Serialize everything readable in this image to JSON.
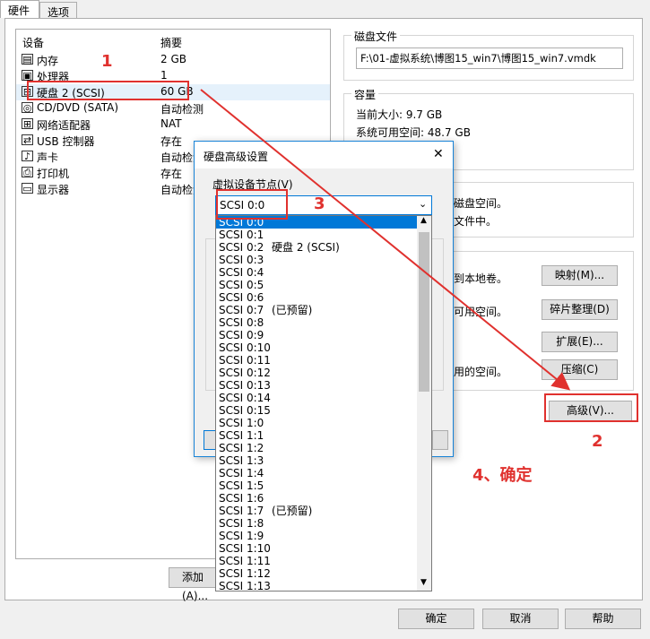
{
  "tabs": [
    "硬件",
    "选项"
  ],
  "device_list": {
    "col_device": "设备",
    "col_summary": "摘要",
    "rows": [
      {
        "icon": "memory-icon",
        "name": "内存",
        "summary": "2 GB"
      },
      {
        "icon": "cpu-icon",
        "name": "处理器",
        "summary": "1"
      },
      {
        "icon": "hard-disk-icon",
        "name": "硬盘 2 (SCSI)",
        "summary": "60 GB"
      },
      {
        "icon": "cd-dvd-icon",
        "name": "CD/DVD (SATA)",
        "summary": "自动检测"
      },
      {
        "icon": "network-adapter-icon",
        "name": "网络适配器",
        "summary": "NAT"
      },
      {
        "icon": "usb-icon",
        "name": "USB 控制器",
        "summary": "存在"
      },
      {
        "icon": "sound-icon",
        "name": "声卡",
        "summary": "自动检测"
      },
      {
        "icon": "printer-icon",
        "name": "打印机",
        "summary": "存在"
      },
      {
        "icon": "display-icon",
        "name": "显示器",
        "summary": "自动检测"
      }
    ]
  },
  "add_button": "添加(A)...",
  "disk_file": {
    "title": "磁盘文件",
    "path": "F:\\01-虚拟系统\\博图15_win7\\博图15_win7.vmdk"
  },
  "capacity": {
    "title": "容量",
    "current_size": "当前大小: 9.7 GB",
    "free_space": "系统可用空间: 48.7 GB"
  },
  "disk_info": {
    "line1": "磁盘空间。",
    "line2": "文件中。"
  },
  "utilities": {
    "map_text": "到本地卷。",
    "map_btn": "映射(M)...",
    "defrag_text": "可用空间。",
    "defrag_btn": "碎片整理(D)",
    "expand_btn": "扩展(E)...",
    "compact_text": "用的空间。",
    "compact_btn": "压缩(C)"
  },
  "advanced_btn": "高级(V)...",
  "bottom": {
    "ok": "确定",
    "cancel": "取消",
    "help": "帮助"
  },
  "dialog": {
    "title": "硬盘高级设置",
    "close": "✕",
    "node_label": "虚拟设备节点(V)",
    "selected": "SCSI 0:0",
    "options": [
      {
        "label": "SCSI 0:0",
        "extra": ""
      },
      {
        "label": "SCSI 0:1",
        "extra": ""
      },
      {
        "label": "SCSI 0:2",
        "extra": "硬盘 2 (SCSI)"
      },
      {
        "label": "SCSI 0:3",
        "extra": ""
      },
      {
        "label": "SCSI 0:4",
        "extra": ""
      },
      {
        "label": "SCSI 0:5",
        "extra": ""
      },
      {
        "label": "SCSI 0:6",
        "extra": ""
      },
      {
        "label": "SCSI 0:7",
        "extra": "(已预留)"
      },
      {
        "label": "SCSI 0:8",
        "extra": ""
      },
      {
        "label": "SCSI 0:9",
        "extra": ""
      },
      {
        "label": "SCSI 0:10",
        "extra": ""
      },
      {
        "label": "SCSI 0:11",
        "extra": ""
      },
      {
        "label": "SCSI 0:12",
        "extra": ""
      },
      {
        "label": "SCSI 0:13",
        "extra": ""
      },
      {
        "label": "SCSI 0:14",
        "extra": ""
      },
      {
        "label": "SCSI 0:15",
        "extra": ""
      },
      {
        "label": "SCSI 1:0",
        "extra": ""
      },
      {
        "label": "SCSI 1:1",
        "extra": ""
      },
      {
        "label": "SCSI 1:2",
        "extra": ""
      },
      {
        "label": "SCSI 1:3",
        "extra": ""
      },
      {
        "label": "SCSI 1:4",
        "extra": ""
      },
      {
        "label": "SCSI 1:5",
        "extra": ""
      },
      {
        "label": "SCSI 1:6",
        "extra": ""
      },
      {
        "label": "SCSI 1:7",
        "extra": "(已预留)"
      },
      {
        "label": "SCSI 1:8",
        "extra": ""
      },
      {
        "label": "SCSI 1:9",
        "extra": ""
      },
      {
        "label": "SCSI 1:10",
        "extra": ""
      },
      {
        "label": "SCSI 1:11",
        "extra": ""
      },
      {
        "label": "SCSI 1:12",
        "extra": ""
      },
      {
        "label": "SCSI 1:13",
        "extra": ""
      }
    ]
  },
  "annotations": {
    "n1": "1",
    "n2": "2",
    "n3": "3",
    "n4": "4、确定",
    "color": "#e0312e"
  }
}
